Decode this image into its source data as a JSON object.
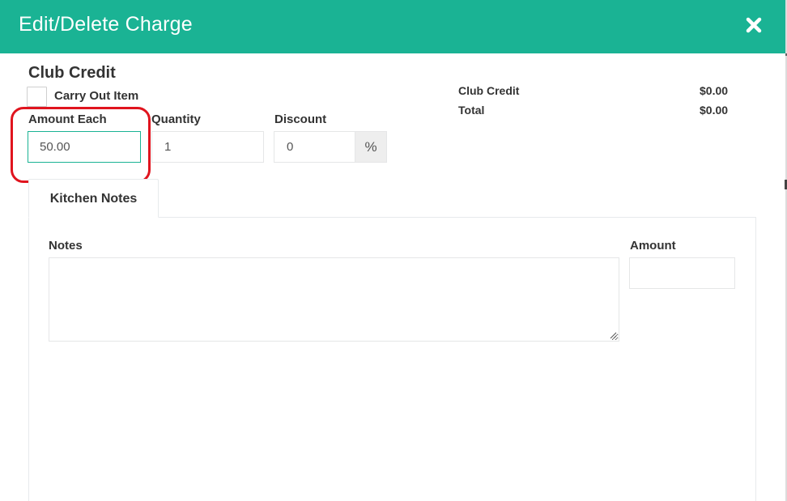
{
  "modal": {
    "title": "Edit/Delete Charge",
    "close_icon": "close-icon",
    "header_color": "#1ab394"
  },
  "item": {
    "name": "Club Credit",
    "carry_out_label": "Carry Out Item",
    "carry_out_checked": false
  },
  "summary": {
    "rows": [
      {
        "label": "Club Credit",
        "value": "$0.00"
      },
      {
        "label": "Total",
        "value": "$0.00"
      }
    ]
  },
  "fields": {
    "amount_each": {
      "label": "Amount Each",
      "value": "50.00"
    },
    "quantity": {
      "label": "Quantity",
      "value": "1"
    },
    "discount": {
      "label": "Discount",
      "value": "0",
      "addon": "%"
    }
  },
  "annotation": {
    "highlight_color": "#e0141e"
  },
  "tabs": [
    {
      "label": "Kitchen Notes",
      "active": true
    }
  ],
  "kitchen_notes": {
    "notes_label": "Notes",
    "notes_value": "",
    "amount_label": "Amount",
    "amount_value": ""
  }
}
